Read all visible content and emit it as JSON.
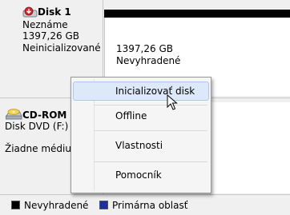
{
  "disk1": {
    "name": "Disk 1",
    "type": "Neznáme",
    "size": "1397,26 GB",
    "status": "Neinicializované",
    "partition": {
      "size": "1397,26 GB",
      "state": "Nevyhradené"
    }
  },
  "cdrom": {
    "name": "CD-ROM",
    "type": "Disk DVD (F:)",
    "status": "Žiadne médiu"
  },
  "context_menu": {
    "items": [
      {
        "label": "Inicializovať disk"
      },
      {
        "label": "Offline"
      },
      {
        "label": "Vlastnosti"
      },
      {
        "label": "Pomocník"
      }
    ]
  },
  "legend": {
    "items": [
      {
        "label": "Nevyhradené",
        "color": "#000000"
      },
      {
        "label": "Primárna oblasť",
        "color": "#1a2fa0"
      }
    ]
  },
  "colors": {
    "unallocated": "#000000",
    "primary": "#1a2fa0",
    "highlight": "#dde9f9"
  }
}
